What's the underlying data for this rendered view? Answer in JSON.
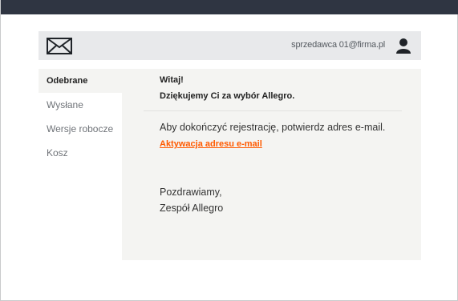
{
  "header": {
    "user_email": "sprzedawca 01@firma.pl",
    "icons": {
      "mail": "envelope-icon",
      "user": "user-avatar-icon"
    }
  },
  "sidebar": {
    "items": [
      {
        "label": "Odebrane",
        "active": true
      },
      {
        "label": "Wysłane",
        "active": false
      },
      {
        "label": "Wersje robocze",
        "active": false
      },
      {
        "label": "Kosz",
        "active": false
      }
    ]
  },
  "message": {
    "greeting": "Witaj!",
    "thanks": "Dziękujemy Ci za wybór Allegro.",
    "body": "Aby dokończyć rejestrację, potwierdz adres e-mail.",
    "link_label": "Aktywacja adresu e-mail",
    "closing": "Pozdrawiamy,",
    "signature": "Zespół Allegro"
  },
  "colors": {
    "topbar": "#2f3542",
    "header_bg": "#e8e9eb",
    "content_bg": "#f4f4f2",
    "link": "#ff5a00"
  }
}
